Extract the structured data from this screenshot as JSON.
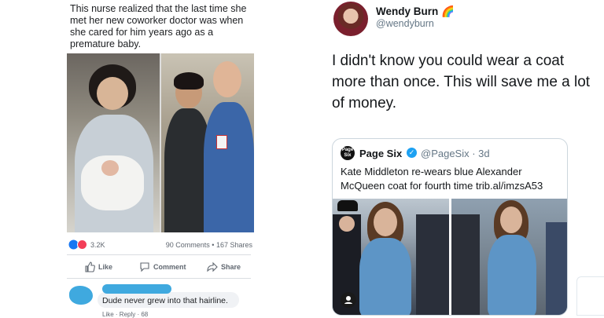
{
  "facebook_post": {
    "text": "This nurse realized that the last time she met her new coworker doctor was when she cared for him years ago as a premature baby.",
    "reaction_count": "3.2K",
    "comments_shares": "90 Comments • 167 Shares",
    "actions": {
      "like": "Like",
      "comment": "Comment",
      "share": "Share"
    },
    "comment_text": "Dude never grew into that hairline.",
    "bottom_partial": "Like · Reply · 68"
  },
  "tweet": {
    "author_name": "Wendy Burn",
    "author_emoji": "🌈",
    "handle": "@wendyburn",
    "text": "I didn't know you could wear a coat more than once. This will save me a lot of money.",
    "quote": {
      "logo_text": "Page Six",
      "name": "Page Six",
      "handle_time": "@PageSix · 3d",
      "text": "Kate Middleton re-wears blue Alexander McQueen coat for fourth time trib.al/imzsA53"
    }
  },
  "colors": {
    "twitter_blue": "#1da1f2",
    "facebook_gray": "#606770",
    "redaction_blue": "#3fa9df",
    "coat_blue": "#5d95c6"
  }
}
